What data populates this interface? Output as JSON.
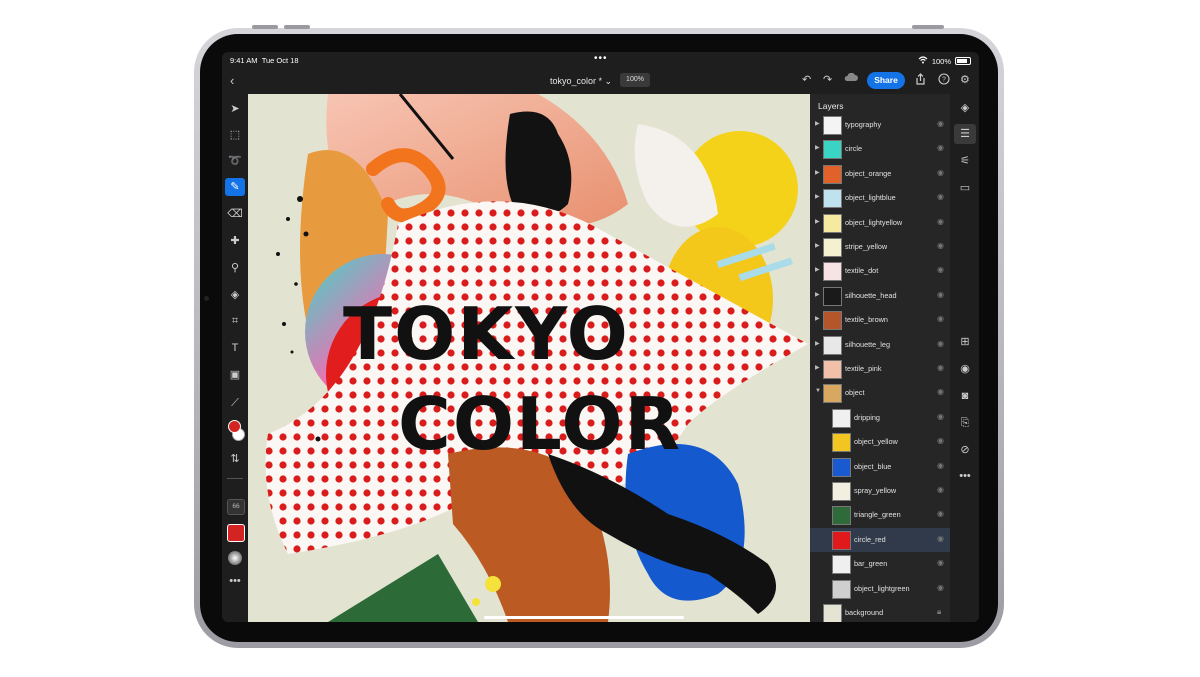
{
  "status": {
    "time": "9:41 AM",
    "date": "Tue Oct 18",
    "battery": "100%"
  },
  "document": {
    "name": "tokyo_color *",
    "zoom": "100%"
  },
  "toolbar": {
    "share_label": "Share"
  },
  "canvas": {
    "line1": "TOKYO",
    "line2": "COLOR"
  },
  "brush_size": "66",
  "colors": {
    "foreground": "#d42323",
    "background": "#ffffff",
    "accent": "#1473e6"
  },
  "layers": {
    "title": "Layers",
    "items": [
      {
        "name": "typography",
        "group": true,
        "indent": false,
        "thumb": "#f4f4f4"
      },
      {
        "name": "circle",
        "group": true,
        "indent": false,
        "thumb": "#39d4c4"
      },
      {
        "name": "object_orange",
        "group": true,
        "indent": false,
        "thumb": "#e0622a"
      },
      {
        "name": "object_lightblue",
        "group": true,
        "indent": false,
        "thumb": "#bfe3ee"
      },
      {
        "name": "object_lightyellow",
        "group": true,
        "indent": false,
        "thumb": "#f6e9a0"
      },
      {
        "name": "stripe_yellow",
        "group": true,
        "indent": false,
        "thumb": "#f5f0d0"
      },
      {
        "name": "textile_dot",
        "group": true,
        "indent": false,
        "thumb": "#f7e3e3"
      },
      {
        "name": "silhouette_head",
        "group": true,
        "indent": false,
        "thumb": "#1a1a1a"
      },
      {
        "name": "textile_brown",
        "group": true,
        "indent": false,
        "thumb": "#b5562a"
      },
      {
        "name": "silhouette_leg",
        "group": true,
        "indent": false,
        "thumb": "#e8e8e8"
      },
      {
        "name": "textile_pink",
        "group": true,
        "indent": false,
        "thumb": "#f2c0a8"
      },
      {
        "name": "object",
        "group": true,
        "expanded": true,
        "indent": false,
        "thumb": "#d9a860"
      },
      {
        "name": "dripping",
        "group": false,
        "indent": true,
        "thumb": "#f0f0f0"
      },
      {
        "name": "object_yellow",
        "group": false,
        "indent": true,
        "thumb": "#f2c521"
      },
      {
        "name": "object_blue",
        "group": false,
        "indent": true,
        "thumb": "#1a5ad0"
      },
      {
        "name": "spray_yellow",
        "group": false,
        "indent": true,
        "thumb": "#f3efe0"
      },
      {
        "name": "triangle_green",
        "group": false,
        "indent": true,
        "thumb": "#2e6a3a"
      },
      {
        "name": "circle_red",
        "group": false,
        "indent": true,
        "thumb": "#e01a1a",
        "selected": true
      },
      {
        "name": "bar_green",
        "group": false,
        "indent": true,
        "thumb": "#efefef"
      },
      {
        "name": "object_lightgreen",
        "group": false,
        "indent": true,
        "thumb": "#cfcfcf"
      },
      {
        "name": "background",
        "group": false,
        "indent": false,
        "thumb": "#e5e4d4",
        "locked": true
      }
    ]
  }
}
